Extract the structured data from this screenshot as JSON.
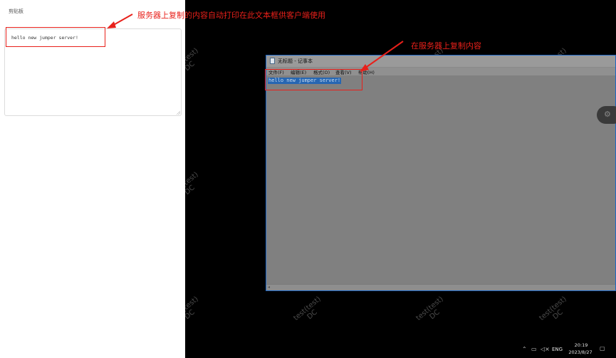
{
  "clipboard_panel": {
    "title": "剪贴板",
    "content": "hello new jumper server!"
  },
  "annotations": {
    "left": "服务器上复制的内容自动打印在此文本框供客户端使用",
    "right": "在服务器上复制内容",
    "color": "#e8201a"
  },
  "notepad": {
    "title": "无标题 - 记事本",
    "menu": [
      "文件(F)",
      "编辑(E)",
      "格式(O)",
      "查看(V)",
      "帮助(H)"
    ],
    "selected_text": "hello new jumper server!"
  },
  "watermark": {
    "line1": "test(test)",
    "line2": "DC"
  },
  "taskbar": {
    "icons": [
      "chevron-up-icon",
      "display-icon",
      "volume-muted-icon"
    ],
    "language": "ENG",
    "time": "20:19",
    "date": "2023/8/27"
  }
}
